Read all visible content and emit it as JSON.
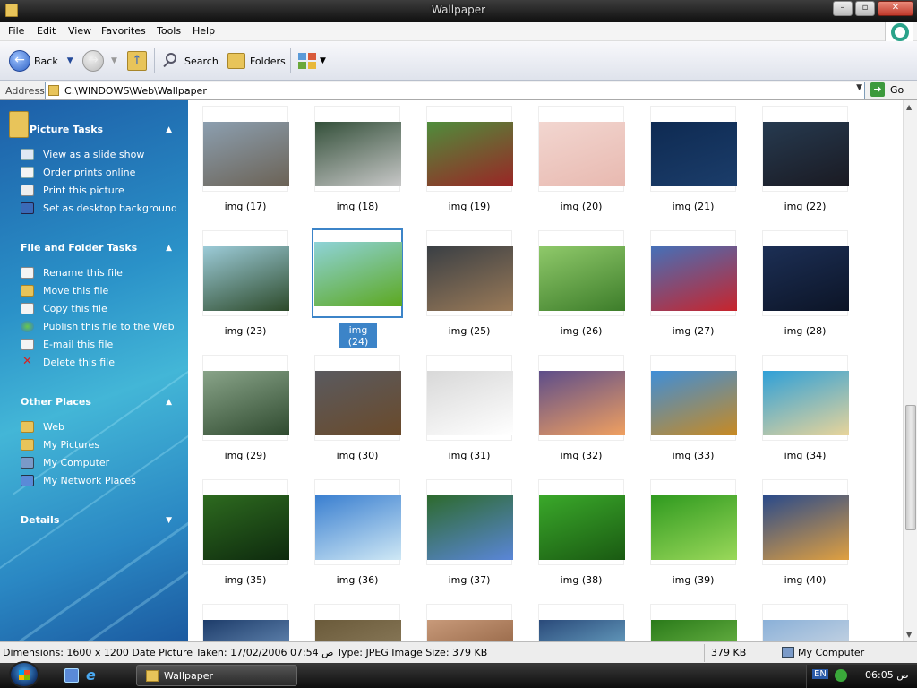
{
  "window": {
    "title": "Wallpaper"
  },
  "menu": [
    "File",
    "Edit",
    "View",
    "Favorites",
    "Tools",
    "Help"
  ],
  "toolbar": {
    "back": "Back",
    "search": "Search",
    "folders": "Folders"
  },
  "address": {
    "label": "Address",
    "path": "C:\\WINDOWS\\Web\\Wallpaper",
    "go": "Go"
  },
  "sidebar": {
    "picture_tasks": {
      "title": "Picture Tasks",
      "items": [
        "View as a slide show",
        "Order prints online",
        "Print this picture",
        "Set as desktop background"
      ]
    },
    "file_tasks": {
      "title": "File and Folder Tasks",
      "items": [
        "Rename this file",
        "Move this file",
        "Copy this file",
        "Publish this file to the Web",
        "E-mail this file",
        "Delete this file"
      ]
    },
    "other_places": {
      "title": "Other Places",
      "items": [
        "Web",
        "My Pictures",
        "My Computer",
        "My Network Places"
      ]
    },
    "details": {
      "title": "Details"
    }
  },
  "files": [
    {
      "name": "img (17)",
      "c1": "#8c9fb0",
      "c2": "#6b6255"
    },
    {
      "name": "img (18)",
      "c1": "#34503a",
      "c2": "#c8c8c8"
    },
    {
      "name": "img (19)",
      "c1": "#4f8d3c",
      "c2": "#9a2525"
    },
    {
      "name": "img (20)",
      "c1": "#f2d6d0",
      "c2": "#e8b9b0"
    },
    {
      "name": "img (21)",
      "c1": "#0e2a52",
      "c2": "#1b3d6a"
    },
    {
      "name": "img (22)",
      "c1": "#263a50",
      "c2": "#1a1a22"
    },
    {
      "name": "img (23)",
      "c1": "#9ccbd8",
      "c2": "#2d4a2a"
    },
    {
      "name": "img (24)",
      "c1": "#8fd3d8",
      "c2": "#5ca81f"
    },
    {
      "name": "img (25)",
      "c1": "#3a3f44",
      "c2": "#9a7a58"
    },
    {
      "name": "img (26)",
      "c1": "#8fc96a",
      "c2": "#3d7d2a"
    },
    {
      "name": "img (27)",
      "c1": "#4570b8",
      "c2": "#c8242c"
    },
    {
      "name": "img (28)",
      "c1": "#1c2f55",
      "c2": "#0c1426"
    },
    {
      "name": "img (29)",
      "c1": "#89a489",
      "c2": "#2f4a2f"
    },
    {
      "name": "img (30)",
      "c1": "#5a5a5f",
      "c2": "#6a4a2a"
    },
    {
      "name": "img (31)",
      "c1": "#d8d8d8",
      "c2": "#ffffff"
    },
    {
      "name": "img (32)",
      "c1": "#5d4d8a",
      "c2": "#f0a060"
    },
    {
      "name": "img (33)",
      "c1": "#3f8ed8",
      "c2": "#c88a22"
    },
    {
      "name": "img (34)",
      "c1": "#2fa0d8",
      "c2": "#e8d49a"
    },
    {
      "name": "img (35)",
      "c1": "#2d6a1f",
      "c2": "#0e2a0e"
    },
    {
      "name": "img (36)",
      "c1": "#3a7fd0",
      "c2": "#cfe8f5"
    },
    {
      "name": "img (37)",
      "c1": "#2d6a2d",
      "c2": "#5a86d8"
    },
    {
      "name": "img (38)",
      "c1": "#3aa82a",
      "c2": "#1a5a12"
    },
    {
      "name": "img (39)",
      "c1": "#2f9a1f",
      "c2": "#9ad85a"
    },
    {
      "name": "img (40)",
      "c1": "#2a4a8a",
      "c2": "#e0a040"
    },
    {
      "name": "",
      "c1": "#1d3c6a",
      "c2": "#8ab0d8"
    },
    {
      "name": "",
      "c1": "#6a5a3a",
      "c2": "#9a8a6a"
    },
    {
      "name": "",
      "c1": "#c89a7a",
      "c2": "#7a4a2a"
    },
    {
      "name": "",
      "c1": "#2a4a7a",
      "c2": "#8ad0e8"
    },
    {
      "name": "",
      "c1": "#2a7a1a",
      "c2": "#8ad05a"
    },
    {
      "name": "",
      "c1": "#8ab0d8",
      "c2": "#e8e8e8"
    }
  ],
  "selected_index": 7,
  "status": {
    "info": "Dimensions: 1600 x 1200 Date Picture Taken: 17/02/2006 07:54 ص Type: JPEG Image Size: 379 KB",
    "size": "379 KB",
    "zone": "My Computer"
  },
  "taskbar": {
    "task": "Wallpaper",
    "lang": "EN",
    "time": "06:05 ص"
  }
}
